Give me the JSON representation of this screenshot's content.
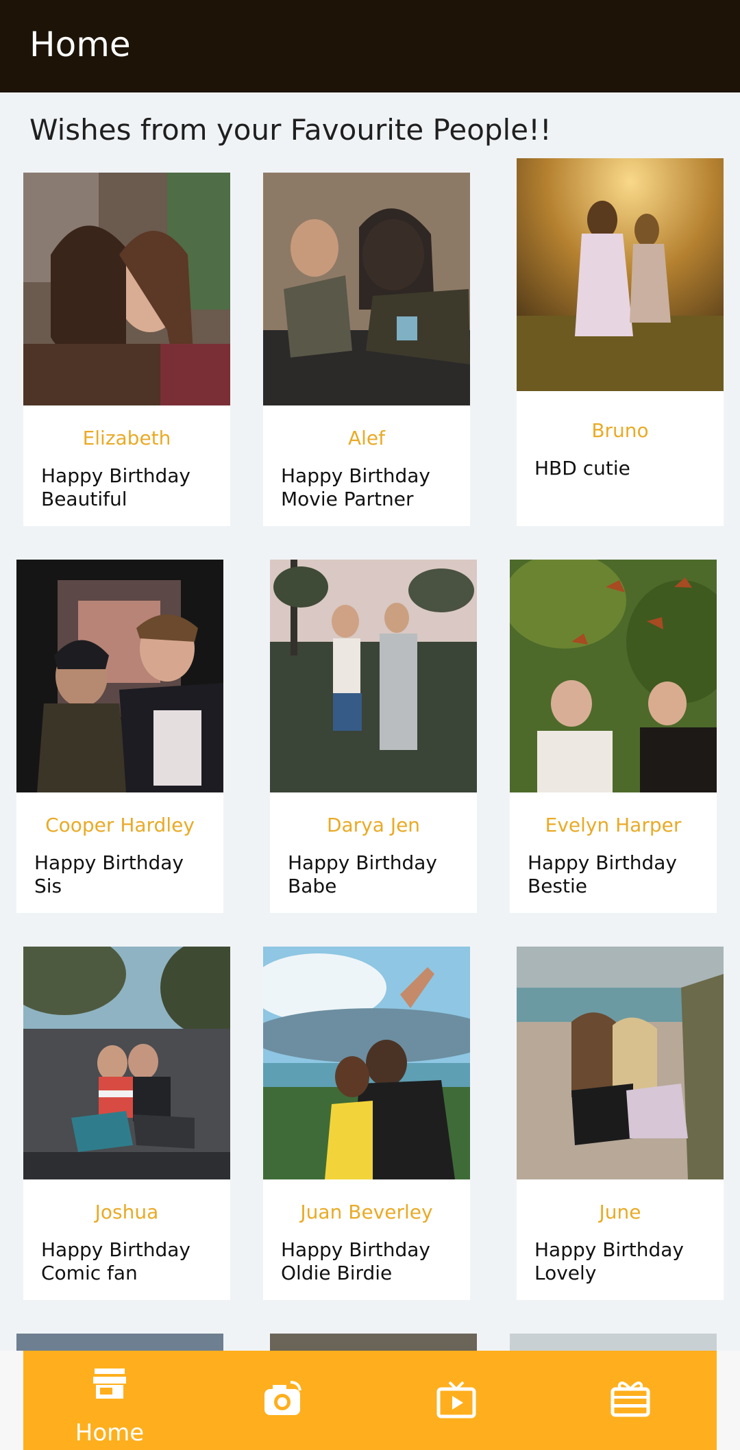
{
  "appbar": {
    "title": "Home"
  },
  "heading": "Wishes from your Favourite People!!",
  "cards": [
    {
      "name": "Elizabeth",
      "message": "Happy Birthday Beautiful"
    },
    {
      "name": "Alef",
      "message": "Happy Birthday Movie Partner"
    },
    {
      "name": "Bruno",
      "message": "HBD cutie"
    },
    {
      "name": "Cooper Hardley",
      "message": "Happy Birthday Sis"
    },
    {
      "name": "Darya Jen",
      "message": "Happy Birthday Babe"
    },
    {
      "name": "Evelyn Harper",
      "message": "Happy Birthday Bestie"
    },
    {
      "name": "Joshua",
      "message": "Happy Birthday Comic fan"
    },
    {
      "name": "Juan Beverley",
      "message": "Happy Birthday Oldie Birdie"
    },
    {
      "name": "June",
      "message": "Happy Birthday Lovely"
    }
  ],
  "nav": {
    "items": [
      {
        "label": "Home",
        "icon": "store-icon",
        "selected": true
      },
      {
        "label": "",
        "icon": "camera-icon",
        "selected": false
      },
      {
        "label": "",
        "icon": "tv-play-icon",
        "selected": false
      },
      {
        "label": "",
        "icon": "gift-card-icon",
        "selected": false
      }
    ]
  },
  "colors": {
    "appbar": "#1d1307",
    "accent": "#ffaf1d",
    "name_text": "#e9aa26",
    "background": "#f0f3f6"
  }
}
